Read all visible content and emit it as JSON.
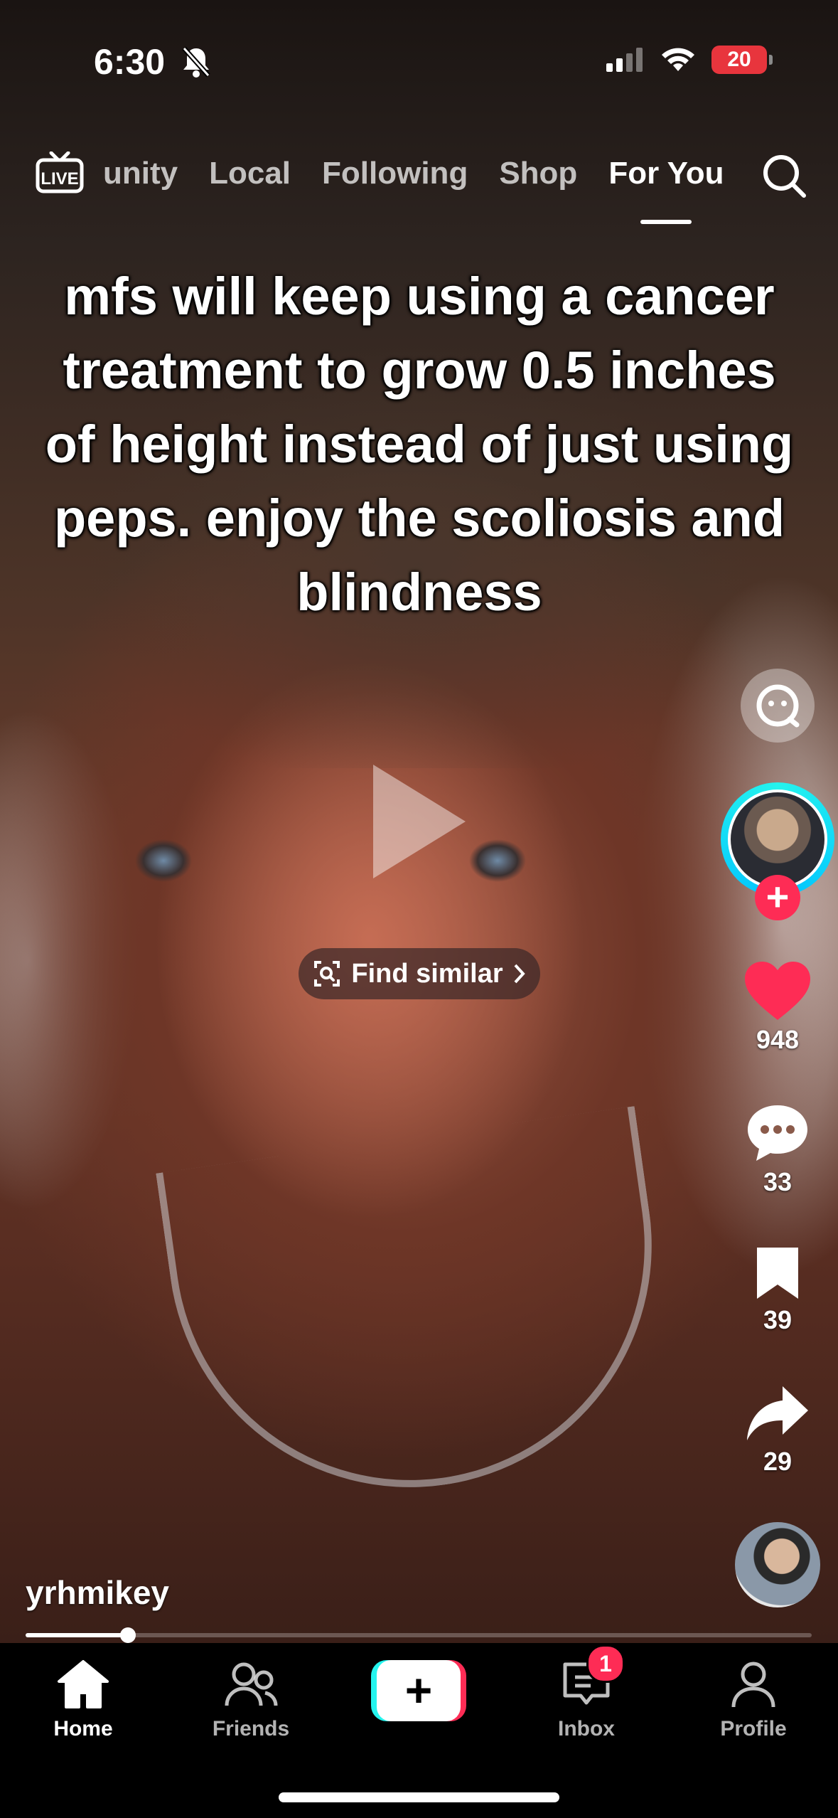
{
  "status_bar": {
    "time": "6:30",
    "battery": "20"
  },
  "top_nav": {
    "tabs": [
      {
        "label": "unity"
      },
      {
        "label": "Local"
      },
      {
        "label": "Following"
      },
      {
        "label": "Shop"
      },
      {
        "label": "For You"
      }
    ],
    "live_label": "LIVE",
    "active_tab": "For You"
  },
  "video": {
    "caption": "mfs will keep using a cancer treatment to grow 0.5 inches of height instead of just using peps. enjoy the scoliosis and blindness",
    "find_similar_label": "Find similar",
    "username": "yrhmikey",
    "progress": 0.13
  },
  "actions": {
    "likes": "948",
    "comments": "33",
    "saves": "39",
    "shares": "29"
  },
  "bottom_nav": {
    "home": "Home",
    "friends": "Friends",
    "inbox": "Inbox",
    "inbox_badge": "1",
    "profile": "Profile"
  },
  "colors": {
    "accent": "#fe2c55",
    "accent_cyan": "#25f4ee",
    "heart": "#fe2c55"
  }
}
